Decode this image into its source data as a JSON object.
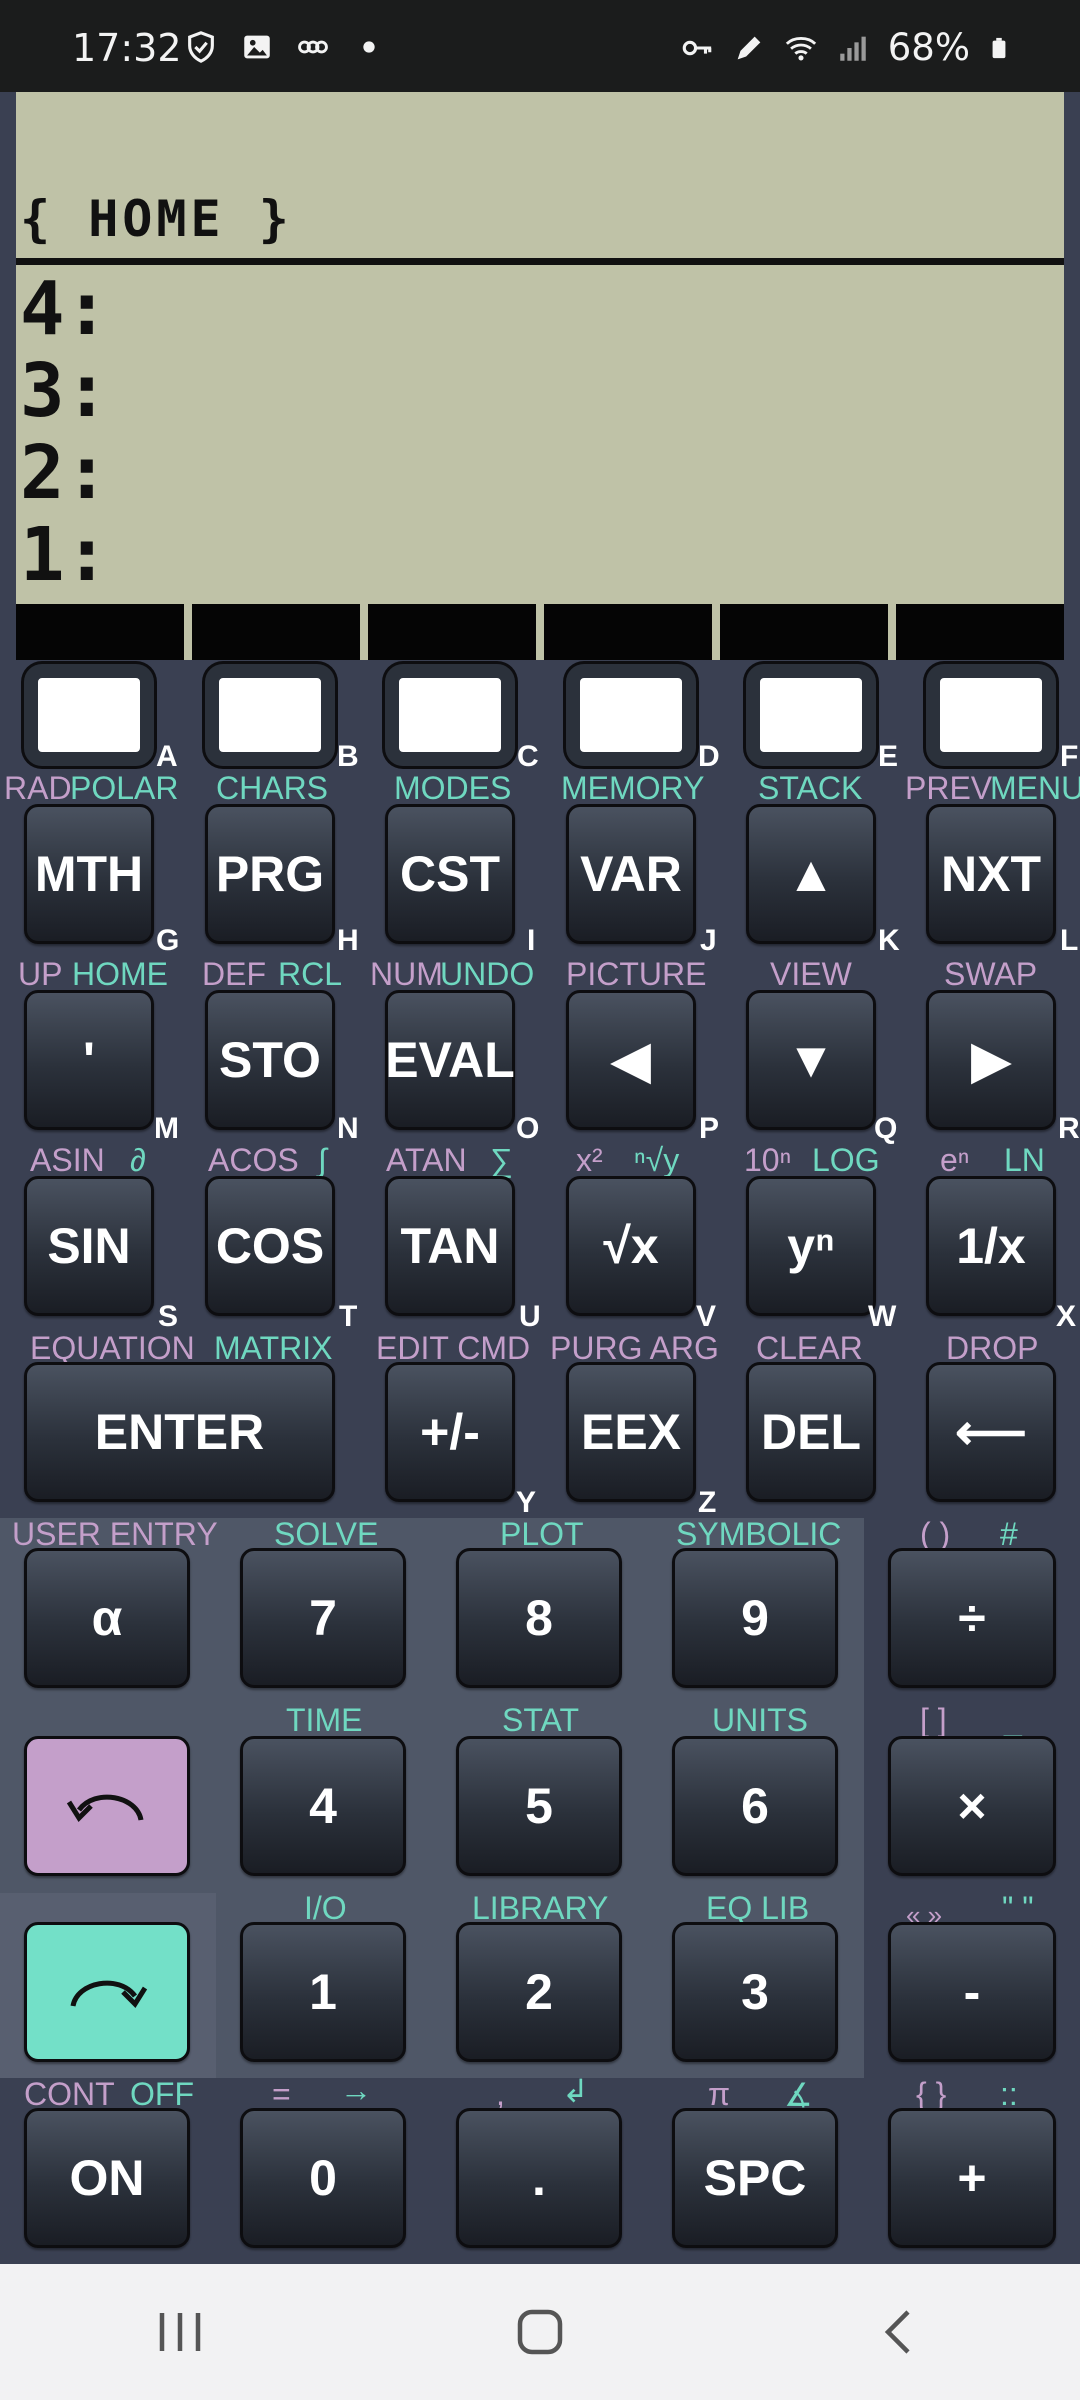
{
  "status": {
    "time": "17:32",
    "battery": "68%"
  },
  "lcd": {
    "path": "{ HOME }",
    "stack": [
      "4:",
      "3:",
      "2:",
      "1:"
    ]
  },
  "soft_keys": [
    {
      "letter": "A"
    },
    {
      "letter": "B"
    },
    {
      "letter": "C"
    },
    {
      "letter": "D"
    },
    {
      "letter": "E"
    },
    {
      "letter": "F"
    }
  ],
  "row1": {
    "labels": [
      "RAD",
      "POLAR",
      "CHARS",
      "MODES",
      "MEMORY",
      "STACK",
      "PREV",
      "MENU"
    ],
    "keys": [
      "MTH",
      "PRG",
      "CST",
      "VAR",
      "▲",
      "NXT"
    ],
    "letters": [
      "G",
      "H",
      "I",
      "J",
      "K",
      "L"
    ]
  },
  "row2": {
    "labels": [
      "UP",
      "HOME",
      "DEF",
      "RCL",
      "NUM",
      "UNDO",
      "PICTURE",
      "VIEW",
      "SWAP"
    ],
    "keys": [
      "'",
      "STO",
      "EVAL",
      "◀",
      "▼",
      "▶"
    ],
    "letters": [
      "M",
      "N",
      "O",
      "P",
      "Q",
      "R"
    ]
  },
  "row3": {
    "labels": [
      "ASIN",
      "∂",
      "ACOS",
      "∫",
      "ATAN",
      "∑",
      "x²",
      "ⁿ√y",
      "10ⁿ",
      "LOG",
      "eⁿ",
      "LN"
    ],
    "keys": [
      "SIN",
      "COS",
      "TAN",
      "√x",
      "yⁿ",
      "1/x"
    ],
    "letters": [
      "S",
      "T",
      "U",
      "V",
      "W",
      "X"
    ]
  },
  "row4": {
    "labels": [
      "EQUATION",
      "MATRIX",
      "EDIT CMD",
      "PURG ARG",
      "CLEAR",
      "DROP"
    ],
    "keys": [
      "ENTER",
      "+/-",
      "EEX",
      "DEL",
      "⟵"
    ],
    "letters": [
      "Y",
      "Z"
    ]
  },
  "row5": {
    "labels": [
      "USER ENTRY",
      "SOLVE",
      "PLOT",
      "SYMBOLIC",
      "( )",
      "#"
    ],
    "keys": [
      "α",
      "7",
      "8",
      "9",
      "÷"
    ]
  },
  "row6": {
    "labels": [
      "TIME",
      "STAT",
      "UNITS",
      "[ ]",
      "_"
    ],
    "keys": [
      "4",
      "5",
      "6",
      "×"
    ]
  },
  "row7": {
    "labels": [
      "I/O",
      "LIBRARY",
      "EQ LIB",
      "« »",
      "\" \""
    ],
    "keys": [
      "1",
      "2",
      "3",
      "-"
    ]
  },
  "row8": {
    "labels": [
      "CONT",
      "OFF",
      "=",
      "→",
      ",",
      "↲",
      "π",
      "∡",
      "{ }",
      "::"
    ],
    "keys": [
      "ON",
      "0",
      ".",
      "SPC",
      "+"
    ]
  },
  "colors": {
    "purple": "#c49fca",
    "teal": "#6fd8c0",
    "lcd": "#bfc2a7",
    "body": "#3a4052"
  }
}
